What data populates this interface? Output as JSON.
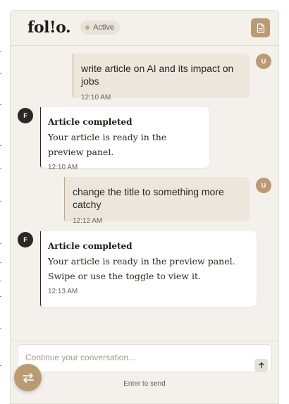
{
  "header": {
    "logo": "fol!o.",
    "status": "Active",
    "icons": {
      "preview": "document-icon"
    }
  },
  "messages": [
    {
      "role": "user",
      "avatar": "U",
      "text": "write article on AI and its impact on jobs",
      "time": "12:10 AM"
    },
    {
      "role": "assistant",
      "avatar": "F",
      "title": "Article completed",
      "text": "Your article is ready in the preview panel.",
      "time": "12:10 AM"
    },
    {
      "role": "user",
      "avatar": "U",
      "text": "change the title to something more catchy",
      "time": "12:12 AM"
    },
    {
      "role": "assistant",
      "avatar": "F",
      "title": "Article completed",
      "text": "Your article is ready in the preview panel. Swipe or use the toggle to view it.",
      "time": "12:13 AM"
    }
  ],
  "composer": {
    "placeholder": "Continue your conversation...",
    "value": "",
    "hint": "Enter to send",
    "icons": {
      "send": "arrow-up-icon",
      "toggle": "swap-arrows-icon"
    }
  },
  "colors": {
    "accent": "#b99a73",
    "panel": "#f4f1ec",
    "user_bubble": "#ece6dc",
    "dark": "#2b2826"
  }
}
